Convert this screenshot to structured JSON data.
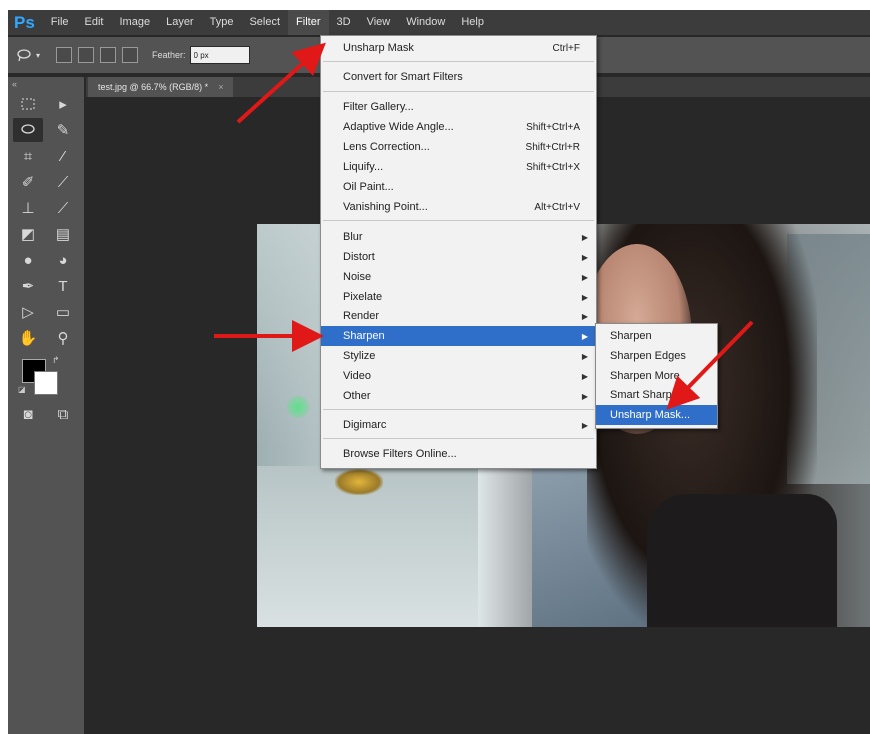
{
  "app": {
    "logo": "Ps"
  },
  "menubar": {
    "items": [
      "File",
      "Edit",
      "Image",
      "Layer",
      "Type",
      "Select",
      "Filter",
      "3D",
      "View",
      "Window",
      "Help"
    ],
    "active": "Filter"
  },
  "options": {
    "feather_label": "Feather:",
    "feather_value": "0 px"
  },
  "document_tab": {
    "title": "test.jpg @ 66.7% (RGB/8) *",
    "close": "×"
  },
  "filter_menu": {
    "items": [
      {
        "label": "Unsharp Mask",
        "shortcut": "Ctrl+F"
      },
      {
        "label": "Convert for Smart Filters"
      },
      {
        "label": "Filter Gallery..."
      },
      {
        "label": "Adaptive Wide Angle...",
        "shortcut": "Shift+Ctrl+A"
      },
      {
        "label": "Lens Correction...",
        "shortcut": "Shift+Ctrl+R"
      },
      {
        "label": "Liquify...",
        "shortcut": "Shift+Ctrl+X"
      },
      {
        "label": "Oil Paint..."
      },
      {
        "label": "Vanishing Point...",
        "shortcut": "Alt+Ctrl+V"
      },
      {
        "label": "Blur"
      },
      {
        "label": "Distort"
      },
      {
        "label": "Noise"
      },
      {
        "label": "Pixelate"
      },
      {
        "label": "Render"
      },
      {
        "label": "Sharpen"
      },
      {
        "label": "Stylize"
      },
      {
        "label": "Video"
      },
      {
        "label": "Other"
      },
      {
        "label": "Digimarc"
      },
      {
        "label": "Browse Filters Online..."
      }
    ],
    "highlighted": "Sharpen"
  },
  "sharpen_submenu": {
    "items": [
      "Sharpen",
      "Sharpen Edges",
      "Sharpen More",
      "Smart Sharpen...",
      "Unsharp Mask..."
    ],
    "highlighted": "Unsharp Mask..."
  },
  "colors": {
    "foreground": "#000000",
    "background": "#ffffff",
    "menu_highlight": "#2f6fc9",
    "annotation_arrow": "#e01818"
  }
}
